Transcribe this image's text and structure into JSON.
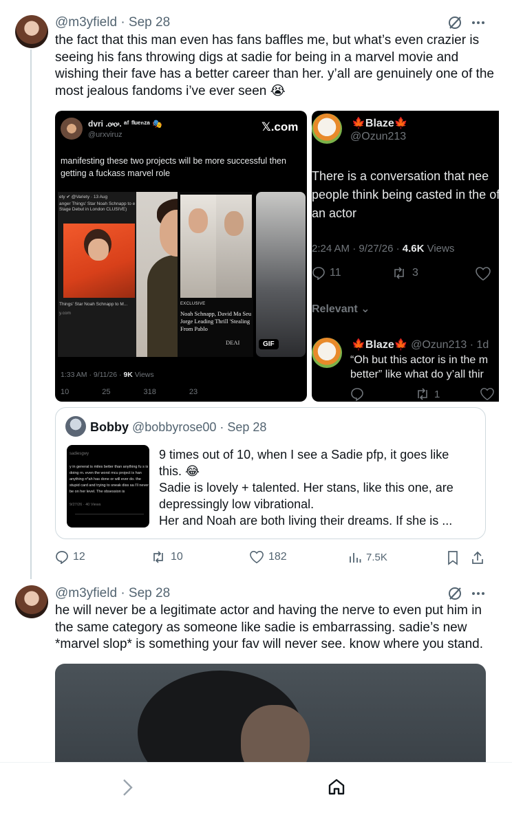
{
  "post1": {
    "handle": "@m3yfield · Sep 28",
    "text": "the fact that this man even has fans baffles me, but what’s even crazier is seeing his fans throwing digs at sadie for being in a marvel movie and wishing their fave has a better career than her. y’all are genuinely one of the most jealous fandoms i’ve ever seen 😭",
    "media_left": {
      "name": "dvri .ꭴꭴ. ᵃᶠ ᶠˡᵘᵉⁿᶻᵃ 🎭",
      "handle": "@urxviruz",
      "logo": "𝕏.com",
      "text": "manifesting these two projects will be more successful then getting a fuckass marvel role",
      "caption_exclusive": "EXCLUSIVE",
      "caption_headline": "Noah Schnapp, David Ma Seu Jorge Leading Thrill 'Stealing From Pablo",
      "caption_deal": "DEAI",
      "gif_label": "GIF",
      "small_source": "ety ✔ @Variety · 13 Aug",
      "small_headline": "anger Things' Star Noah Schnapp to e Stage Debut in London CLUSIVE)",
      "small_caption": "Things' Star Noah Schnapp to M...",
      "small_url": "y.com",
      "timestamp": "1:33 AM · 9/11/26 · ",
      "views_count": "9K",
      "views_label": " Views",
      "stats": [
        "10",
        "25",
        "318",
        "23"
      ]
    },
    "media_right": {
      "name": "Blaze",
      "handle": "@Ozun213",
      "text": "There is a conversation that nee people think being casted in the of an actor",
      "timestamp": "2:24 AM · 9/27/26 · ",
      "views_count": "4.6K",
      "views_label": " Views",
      "replies": "11",
      "reposts": "3",
      "relevant": "Relevant",
      "reply_name": "Blaze",
      "reply_meta": "@Ozun213 · 1d",
      "reply_text": "“Oh but this actor is in the m better” like what do y’all thir",
      "reply_reposts": "1"
    },
    "quote": {
      "name": "Bobby",
      "handle": "@bobbyrose00 · Sep 28",
      "text_line1": "9 times out of 10, when I see a Sadie pfp, it goes like this. 😂",
      "text_line2": "Sadie is lovely + talented. Her stans, like this one, are depressingly low vibrational.",
      "text_line3": "Her and Noah are both living their dreams. If she is ...",
      "thumb_user": "sadiesgwy",
      "thumb_text": "y in general is miles better than anything fu s is doing rn. even the worst mcu project is han anything n*ah has done or will ever do. the stupid card and trying to sneak diss sa i'll never be on her level. The obsession is",
      "thumb_meta": "9/27/26 · 40 Views"
    },
    "actions": {
      "replies": "12",
      "reposts": "10",
      "likes": "182",
      "views": "7.5K"
    }
  },
  "post2": {
    "handle": "@m3yfield · Sep 28",
    "text": "he will never be a legitimate actor and having the nerve to even put him in the same category as someone like sadie is embarrassing. sadie’s new *marvel slop* is something your fav will never see. know where you stand."
  },
  "icons": [
    "grok-icon",
    "more-icon",
    "reply-icon",
    "repost-icon",
    "like-icon",
    "views-icon",
    "bookmark-icon",
    "share-icon",
    "chevron-right-icon",
    "home-icon"
  ]
}
